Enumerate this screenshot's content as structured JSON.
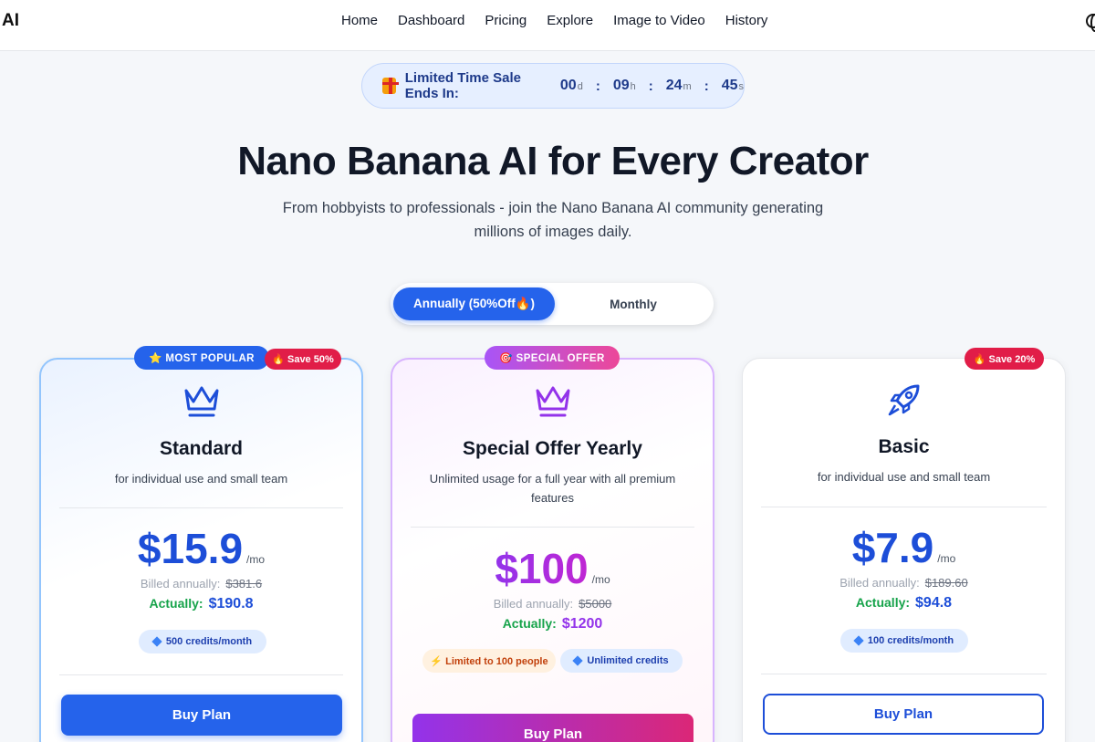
{
  "header": {
    "logo": "AI",
    "nav": [
      "Home",
      "Dashboard",
      "Pricing",
      "Explore",
      "Image to Video",
      "History"
    ]
  },
  "countdown": {
    "label": "Limited Time Sale Ends In:",
    "days": "00",
    "days_unit": "d",
    "hours": "09",
    "hours_unit": "h",
    "minutes": "24",
    "minutes_unit": "m",
    "seconds": "45",
    "seconds_unit": "s"
  },
  "hero": {
    "title": "Nano Banana AI for Every Creator",
    "subtitle": "From hobbyists to professionals - join the Nano Banana AI community generating millions of images daily."
  },
  "billing": {
    "annual_label": "Annually (50%Off🔥)",
    "monthly_label": "Monthly",
    "selected": "annual"
  },
  "plans": [
    {
      "badge": "⭐ MOST POPULAR",
      "save_badge": "🔥 Save 50%",
      "name": "Standard",
      "description": "for individual use and small team",
      "price": "$15.9",
      "per": "/mo",
      "billed_label": "Billed annually:",
      "billed_original": "$381.6",
      "actually_label": "Actually:",
      "actually_value": "$190.8",
      "chips": [
        "500 credits/month"
      ],
      "button": "Buy Plan"
    },
    {
      "badge": "🎯 SPECIAL OFFER",
      "name": "Special Offer Yearly",
      "description": "Unlimited usage for a full year with all premium features",
      "price": "$100",
      "per": "/mo",
      "billed_label": "Billed annually:",
      "billed_original": "$5000",
      "actually_label": "Actually:",
      "actually_value": "$1200",
      "chips": [
        "⚡ Limited to 100 people",
        "Unlimited credits"
      ],
      "button": "Buy Plan"
    },
    {
      "save_badge": "🔥 Save 20%",
      "name": "Basic",
      "description": "for individual use and small team",
      "price": "$7.9",
      "per": "/mo",
      "billed_label": "Billed annually:",
      "billed_original": "$189.60",
      "actually_label": "Actually:",
      "actually_value": "$94.8",
      "chips": [
        "100 credits/month"
      ],
      "button": "Buy Plan"
    }
  ],
  "colors": {
    "primary": "#2563eb",
    "purple": "#9333ea",
    "sale_red": "#e11d48",
    "actually_green": "#16a34a"
  }
}
